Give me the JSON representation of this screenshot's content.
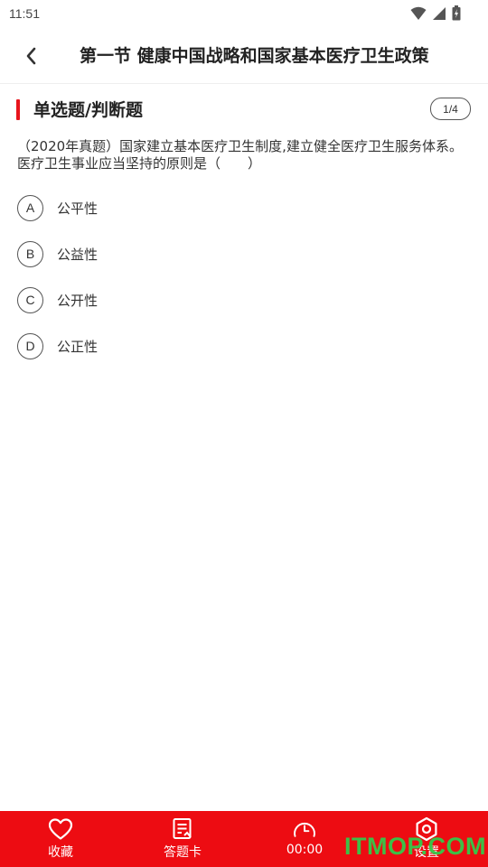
{
  "status_bar": {
    "time": "11:51"
  },
  "header": {
    "title": "第一节 健康中国战略和国家基本医疗卫生政策"
  },
  "section": {
    "title": "单选题/判断题",
    "progress": "1/4"
  },
  "question": {
    "text": "（2020年真题）国家建立基本医疗卫生制度,建立健全医疗卫生服务体系。医疗卫生事业应当坚持的原则是（　　）"
  },
  "options": [
    {
      "letter": "A",
      "text": "公平性"
    },
    {
      "letter": "B",
      "text": "公益性"
    },
    {
      "letter": "C",
      "text": "公开性"
    },
    {
      "letter": "D",
      "text": "公正性"
    }
  ],
  "bottom_bar": {
    "favorite_label": "收藏",
    "answer_card_label": "答题卡",
    "timer_label": "00:00",
    "settings_label": "设置"
  },
  "watermark": "ITMOP.COM",
  "colors": {
    "accent": "#e8141c",
    "bottom_bar": "#ed0c12",
    "watermark": "#34c94a"
  },
  "icons": [
    "wifi-icon",
    "signal-icon",
    "battery-icon",
    "back-chevron-icon",
    "heart-icon",
    "answer-card-icon",
    "timer-icon",
    "settings-icon"
  ]
}
